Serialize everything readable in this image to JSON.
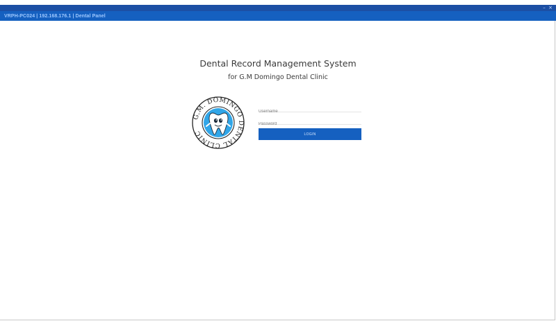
{
  "window": {
    "title": "VRPH-PC024 | 192.168.176.1 |  Dental Panel",
    "minimize_symbol": "–",
    "close_symbol": "×"
  },
  "header": {
    "title": "Dental Record Management System",
    "subtitle": "for G.M Domingo Dental Clinic"
  },
  "logo": {
    "icon": "tooth-mascot-icon",
    "ring_text": "G.M. DOMINGO DENTAL CLINIC"
  },
  "login": {
    "username_placeholder": "Username",
    "username_value": "",
    "password_placeholder": "Password",
    "password_value": "",
    "button_label": "LOGIN"
  },
  "colors": {
    "titlebar_dark": "#1c4fa4",
    "titlebar": "#1560c0",
    "button": "#1560c0",
    "logo_blue": "#31a6e8"
  }
}
